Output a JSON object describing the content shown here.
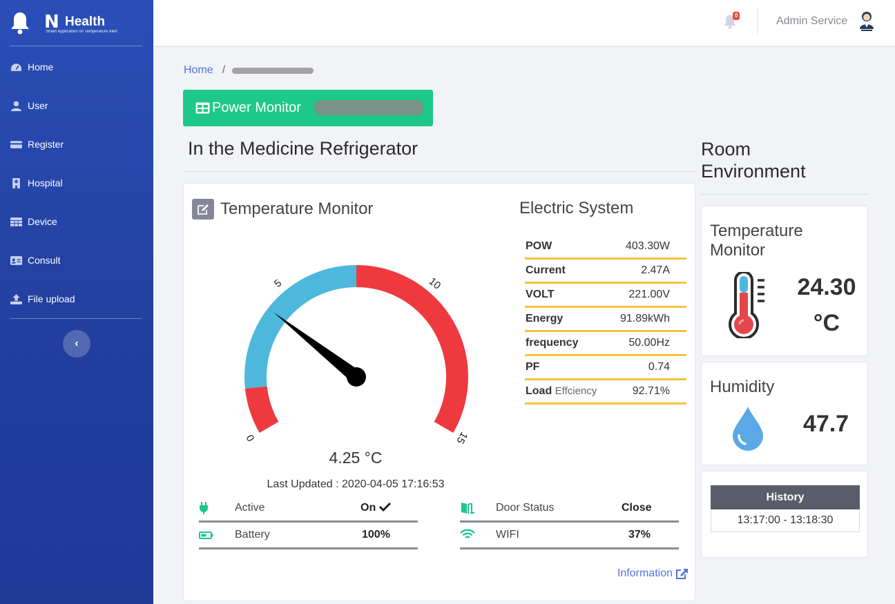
{
  "sidebar": {
    "brand": {
      "logo_letter": "N",
      "logo_name": "Health",
      "tagline": "Smart Application on Temperature Alert"
    },
    "items": [
      {
        "label": "Home",
        "icon": "dashboard-icon"
      },
      {
        "label": "User",
        "icon": "user-icon"
      },
      {
        "label": "Register",
        "icon": "card-icon"
      },
      {
        "label": "Hospital",
        "icon": "hospital-icon"
      },
      {
        "label": "Device",
        "icon": "grid-icon"
      },
      {
        "label": "Consult",
        "icon": "id-card-icon"
      },
      {
        "label": "File upload",
        "icon": "upload-icon"
      }
    ],
    "collapse": "‹"
  },
  "topbar": {
    "notification_count": "0",
    "user_name": "Admin Service"
  },
  "breadcrumb": {
    "home": "Home",
    "separator": "/"
  },
  "power_button": {
    "label": "Power Monitor"
  },
  "main": {
    "title": "In the Medicine Refrigerator",
    "temperature_monitor": {
      "title": "Temperature Monitor",
      "gauge": {
        "min": 0,
        "max": 15,
        "value": 4.25,
        "ticks": [
          "0",
          "5",
          "10",
          "15"
        ],
        "cold_range": [
          1.5,
          7.5
        ]
      },
      "value_text": "4.25 °C",
      "last_updated": "Last Updated : 2020-04-05 17:16:53"
    },
    "electric_system": {
      "title": "Electric System",
      "rows": [
        {
          "label": "POW",
          "sub": "",
          "value": "403.30W"
        },
        {
          "label": "Current",
          "sub": "",
          "value": "2.47A"
        },
        {
          "label": "VOLT",
          "sub": "",
          "value": "221.00V"
        },
        {
          "label": "Energy",
          "sub": "",
          "value": "91.89kWh"
        },
        {
          "label": "frequency",
          "sub": "",
          "value": "50.00Hz"
        },
        {
          "label": "PF",
          "sub": "",
          "value": "0.74"
        },
        {
          "label": "Load",
          "sub": "Effciency",
          "value": "92.71%"
        }
      ]
    },
    "status": {
      "active": {
        "label": "Active",
        "value": "On",
        "value_icon": "check-icon"
      },
      "battery": {
        "label": "Battery",
        "value": "100%"
      },
      "door": {
        "label": "Door Status",
        "value": "Close"
      },
      "wifi": {
        "label": "WIFI",
        "value": "37%"
      }
    },
    "info_link": "Information",
    "colors": {
      "green": "#1cc88a",
      "gauge_blue": "#4db8dc",
      "gauge_red": "#ee3a3f",
      "underline_yellow": "#f6c23e",
      "sidebar_blue": "#2a4fb8"
    }
  },
  "room": {
    "title": "Room Environment",
    "temperature": {
      "title": "Temperature Monitor",
      "value": "24.30",
      "unit": "°C"
    },
    "humidity": {
      "title": "Humidity",
      "value": "47.7"
    },
    "history": {
      "header": "History",
      "range": "13:17:00 - 13:18:30"
    }
  }
}
